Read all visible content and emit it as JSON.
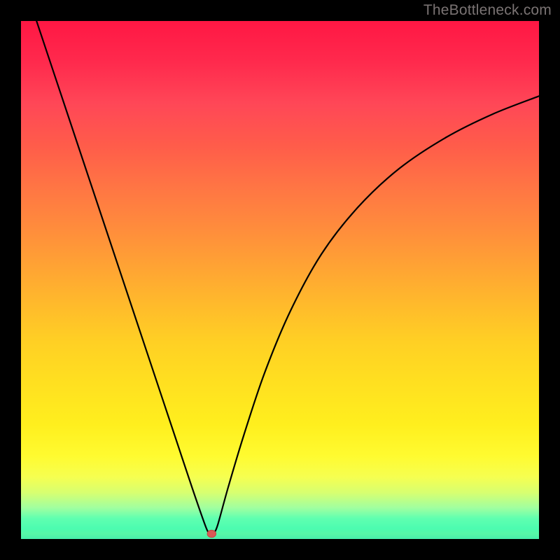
{
  "watermark": "TheBottleneck.com",
  "colors": {
    "frame": "#000000",
    "gradient_top": "#ff1744",
    "gradient_mid1": "#ff8c3c",
    "gradient_mid2": "#ffef1e",
    "gradient_bottom": "#48efab",
    "curve": "#000000",
    "marker_fill": "#d85a56",
    "marker_stroke": "#c24744"
  },
  "chart_data": {
    "type": "line",
    "title": "",
    "xlabel": "",
    "ylabel": "",
    "xlim": [
      0,
      100
    ],
    "ylim": [
      0,
      100
    ],
    "grid": false,
    "legend": false,
    "series": [
      {
        "name": "left-curve",
        "x": [
          3,
          7,
          11,
          15,
          19,
          23,
          27,
          30,
          33,
          35.5,
          36.2
        ],
        "values": [
          100,
          88,
          76,
          64,
          52,
          40,
          28,
          19,
          10,
          2.8,
          1.2
        ]
      },
      {
        "name": "right-curve",
        "x": [
          37.3,
          38,
          40,
          43,
          47,
          52,
          58,
          65,
          73,
          82,
          91,
          100
        ],
        "values": [
          1.2,
          2.8,
          10,
          20,
          32,
          44,
          55,
          64,
          71.5,
          77.5,
          82,
          85.5
        ]
      }
    ],
    "markers": [
      {
        "name": "vertex-marker",
        "x": 36.8,
        "y": 1.0,
        "shape": "ellipse"
      }
    ],
    "annotations": [
      {
        "text": "TheBottleneck.com",
        "position": "top-right"
      }
    ]
  }
}
